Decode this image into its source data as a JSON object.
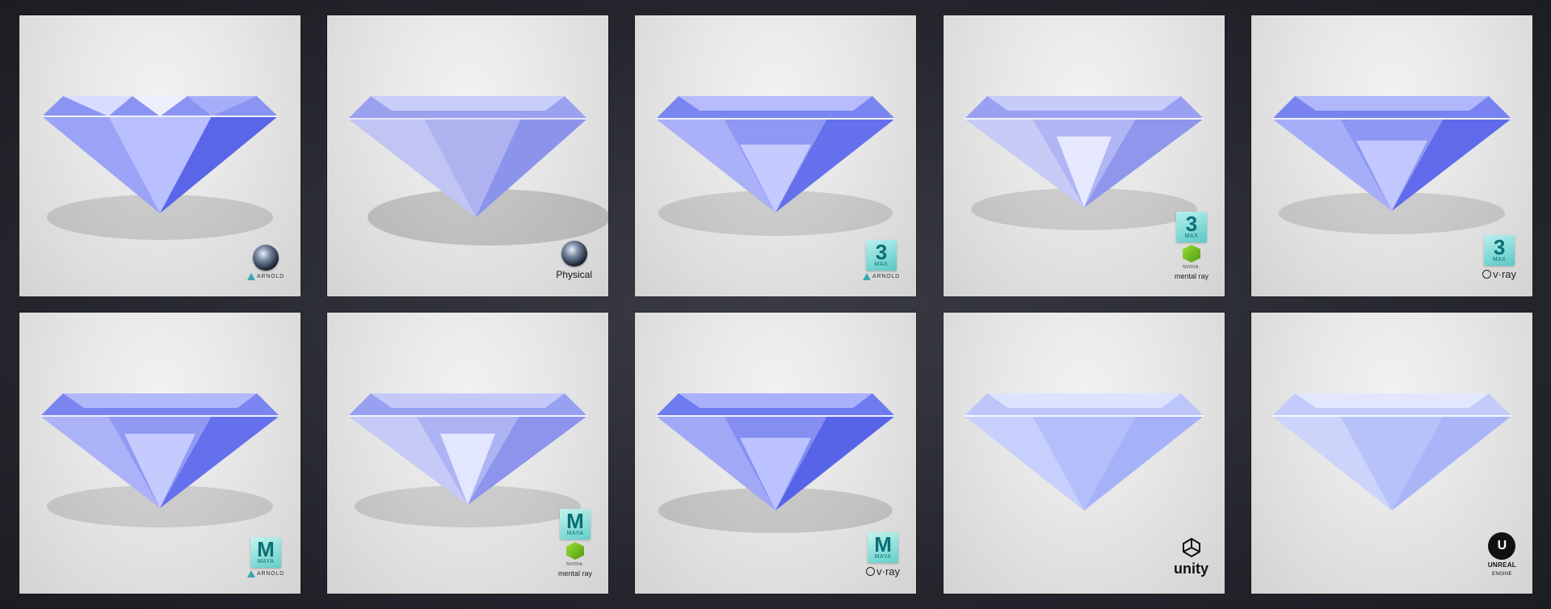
{
  "tiles": [
    {
      "id": "c4d-arnold",
      "badge": {
        "top_logo": "cinema4d-icon",
        "label": "ARNOLD",
        "label_logo": "arnold-icon"
      },
      "style": "cut"
    },
    {
      "id": "c4d-physical",
      "badge": {
        "top_logo": "cinema4d-icon",
        "label": "Physical"
      },
      "style": "soft"
    },
    {
      "id": "3dsmax-arnold",
      "badge": {
        "top_logo": "3dsmax-icon",
        "top_text": "3",
        "top_sub": "MAX",
        "label": "ARNOLD",
        "label_logo": "arnold-icon"
      },
      "style": "cut"
    },
    {
      "id": "3dsmax-mentalray",
      "badge": {
        "top_logo": "3dsmax-icon",
        "top_text": "3",
        "top_sub": "MAX",
        "label_pre": "NVIDIA.",
        "label": "mental ray",
        "label_logo": "mentalray-icon"
      },
      "style": "cut"
    },
    {
      "id": "3dsmax-vray",
      "badge": {
        "top_logo": "3dsmax-icon",
        "top_text": "3",
        "top_sub": "MAX",
        "label": "v·ray",
        "label_logo": "vray-icon"
      },
      "style": "cut"
    },
    {
      "id": "maya-arnold",
      "badge": {
        "top_logo": "maya-icon",
        "top_text": "M",
        "top_sub": "MAYA",
        "label": "ARNOLD",
        "label_logo": "arnold-icon"
      },
      "style": "cut"
    },
    {
      "id": "maya-mentalray",
      "badge": {
        "top_logo": "maya-icon",
        "top_text": "M",
        "top_sub": "MAYA",
        "label_pre": "NVIDIA.",
        "label": "mental ray",
        "label_logo": "mentalray-icon"
      },
      "style": "cut"
    },
    {
      "id": "maya-vray",
      "badge": {
        "top_logo": "maya-icon",
        "top_text": "M",
        "top_sub": "MAYA",
        "label": "v·ray",
        "label_logo": "vray-icon"
      },
      "style": "cut"
    },
    {
      "id": "unity",
      "badge": {
        "top_logo": "unity-icon",
        "label": "unity"
      },
      "style": "flat"
    },
    {
      "id": "unreal",
      "badge": {
        "top_logo": "unreal-icon",
        "top_text": "U",
        "label": "UNREAL",
        "label2": "ENGINE"
      },
      "style": "flat"
    }
  ],
  "colors": {
    "gem_light": "#c7ccff",
    "gem_mid": "#7f89f0",
    "gem_dark": "#4b55d6",
    "tile_bg": "#e6e6e6",
    "page_bg": "#2a2b32"
  }
}
